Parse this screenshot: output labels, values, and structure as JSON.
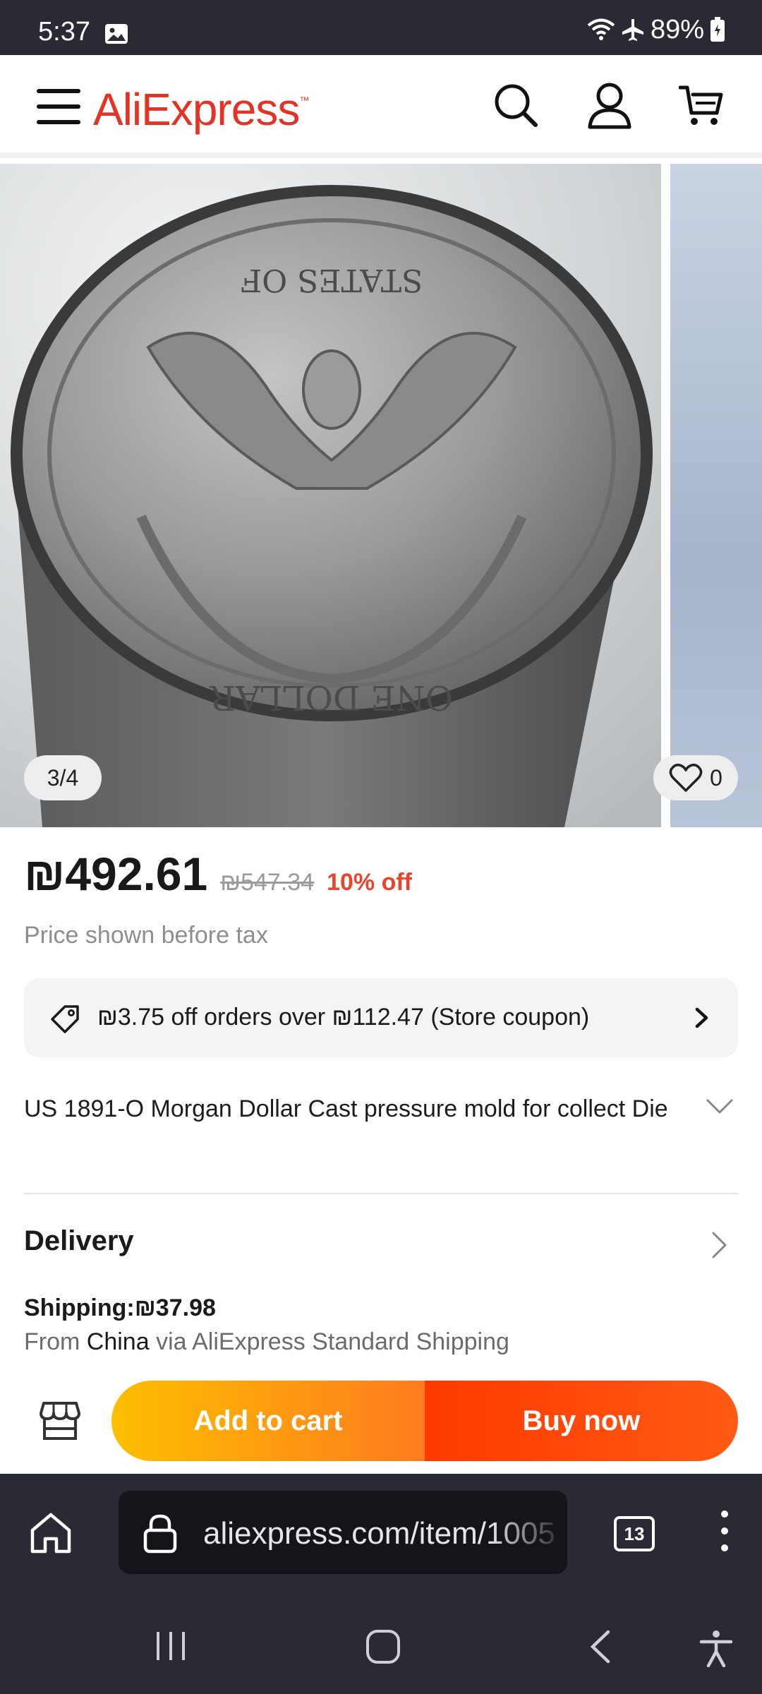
{
  "status_bar": {
    "time": "5:37",
    "battery": "89%"
  },
  "header": {
    "logo": "AliExpress",
    "logo_tm": "™"
  },
  "gallery": {
    "counter": "3/4",
    "wishlist_count": "0"
  },
  "price": {
    "current": "₪492.61",
    "original": "₪547.34",
    "discount": "10% off",
    "tax_note": "Price shown before tax"
  },
  "coupon": {
    "text": "₪3.75 off orders over ₪112.47 (Store coupon)"
  },
  "product": {
    "title": "US 1891-O Morgan Dollar Cast pressure mold for collect Die"
  },
  "delivery": {
    "heading": "Delivery",
    "shipping_label": "Shipping:",
    "shipping_cost": "₪37.98",
    "from_prefix": "From ",
    "origin": "China",
    "via_text": " via AliExpress Standard Shipping"
  },
  "actions": {
    "add_to_cart": "Add to cart",
    "buy_now": "Buy now"
  },
  "browser": {
    "url": "aliexpress.com/item/1005",
    "tab_count": "13"
  },
  "colors": {
    "brand": "#e43225",
    "discount": "#e8452c",
    "cart_gradient_start": "#fdbf00",
    "buy_gradient": "#ff3a00",
    "dark_chrome": "#2a2a35"
  }
}
